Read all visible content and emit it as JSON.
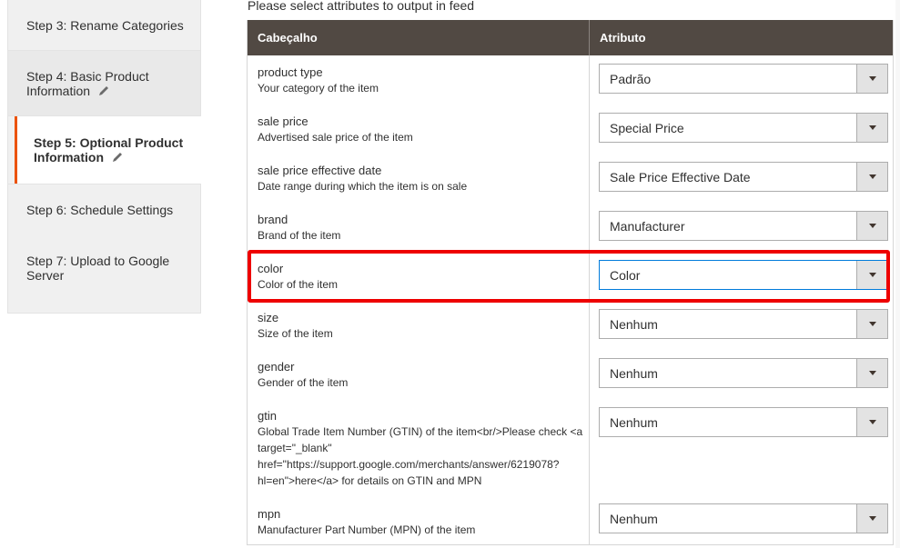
{
  "sidebar": {
    "steps": [
      {
        "label": "Step 3: Rename Categories",
        "editable": false
      },
      {
        "label": "Step 4: Basic Product Information",
        "editable": true
      },
      {
        "label": "Step 5: Optional Product Information",
        "editable": true,
        "active": true
      },
      {
        "label": "Step 6: Schedule Settings",
        "editable": false
      },
      {
        "label": "Step 7: Upload to Google Server",
        "editable": false
      }
    ]
  },
  "main": {
    "intro": "Please select attributes to output in feed",
    "headers": {
      "col1": "Cabeçalho",
      "col2": "Atributo"
    },
    "rows": [
      {
        "name": "product type",
        "desc": "Your category of the item",
        "value": "Padrão"
      },
      {
        "name": "sale price",
        "desc": "Advertised sale price of the item",
        "value": "Special Price"
      },
      {
        "name": "sale price effective date",
        "desc": "Date range during which the item is on sale",
        "value": "Sale Price Effective Date"
      },
      {
        "name": "brand",
        "desc": "Brand of the item",
        "value": "Manufacturer"
      },
      {
        "name": "color",
        "desc": "Color of the item",
        "value": "Color"
      },
      {
        "name": "size",
        "desc": "Size of the item",
        "value": "Nenhum"
      },
      {
        "name": "gender",
        "desc": "Gender of the item",
        "value": "Nenhum"
      },
      {
        "name": "gtin",
        "desc": "Global Trade Item Number (GTIN) of the item<br/>Please check <a target=\"_blank\" href=\"https://support.google.com/merchants/answer/6219078?hl=en\">here</a> for details on GTIN and MPN",
        "value": "Nenhum"
      },
      {
        "name": "mpn",
        "desc": "Manufacturer Part Number (MPN) of the item",
        "value": "Nenhum"
      }
    ]
  },
  "colors": {
    "accent": "#eb5202",
    "header_bg": "#514943",
    "highlight": "#ee0000",
    "focus": "#007bdb"
  }
}
